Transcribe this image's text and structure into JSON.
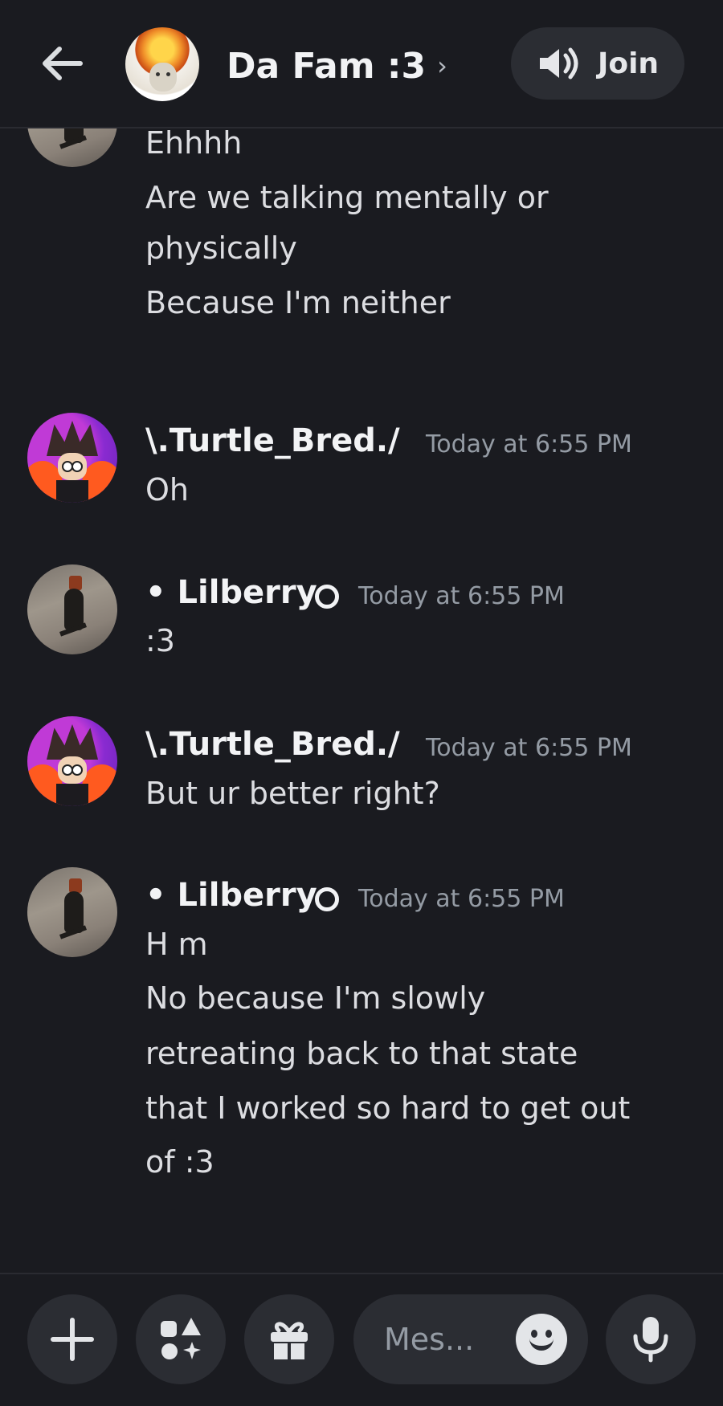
{
  "header": {
    "title": "Da Fam :3",
    "chevron": "›",
    "join_label": "Join",
    "back_icon": "arrow-left-icon",
    "join_icon": "speaker-icon"
  },
  "messages": {
    "partial": {
      "lines": [
        "Ehhhh",
        "Are we talking mentally or",
        "physically",
        "Because I'm neither"
      ]
    },
    "m1": {
      "author": "\\.Turtle_Bred./",
      "time": "Today at 6:55 PM",
      "lines": [
        "Oh"
      ]
    },
    "m2": {
      "author": "• Lilberry",
      "time": "Today at 6:55 PM",
      "lines": [
        ":3"
      ]
    },
    "m3": {
      "author": "\\.Turtle_Bred./",
      "time": "Today at 6:55 PM",
      "lines": [
        "But ur better right?"
      ]
    },
    "m4": {
      "author": "• Lilberry",
      "time": "Today at 6:55 PM",
      "lines": [
        "H m",
        "No because I'm slowly",
        "retreating back to that state",
        "that I worked so hard to get out",
        "of :3"
      ]
    }
  },
  "composer": {
    "placeholder": "Mes...",
    "icons": [
      "plus-icon",
      "apps-icon",
      "gift-icon",
      "emoji-icon",
      "microphone-icon"
    ]
  },
  "colors": {
    "background": "#1a1b20",
    "surface": "#2b2d33",
    "text_primary": "#f2f3f5",
    "text_muted": "#949ba4"
  }
}
